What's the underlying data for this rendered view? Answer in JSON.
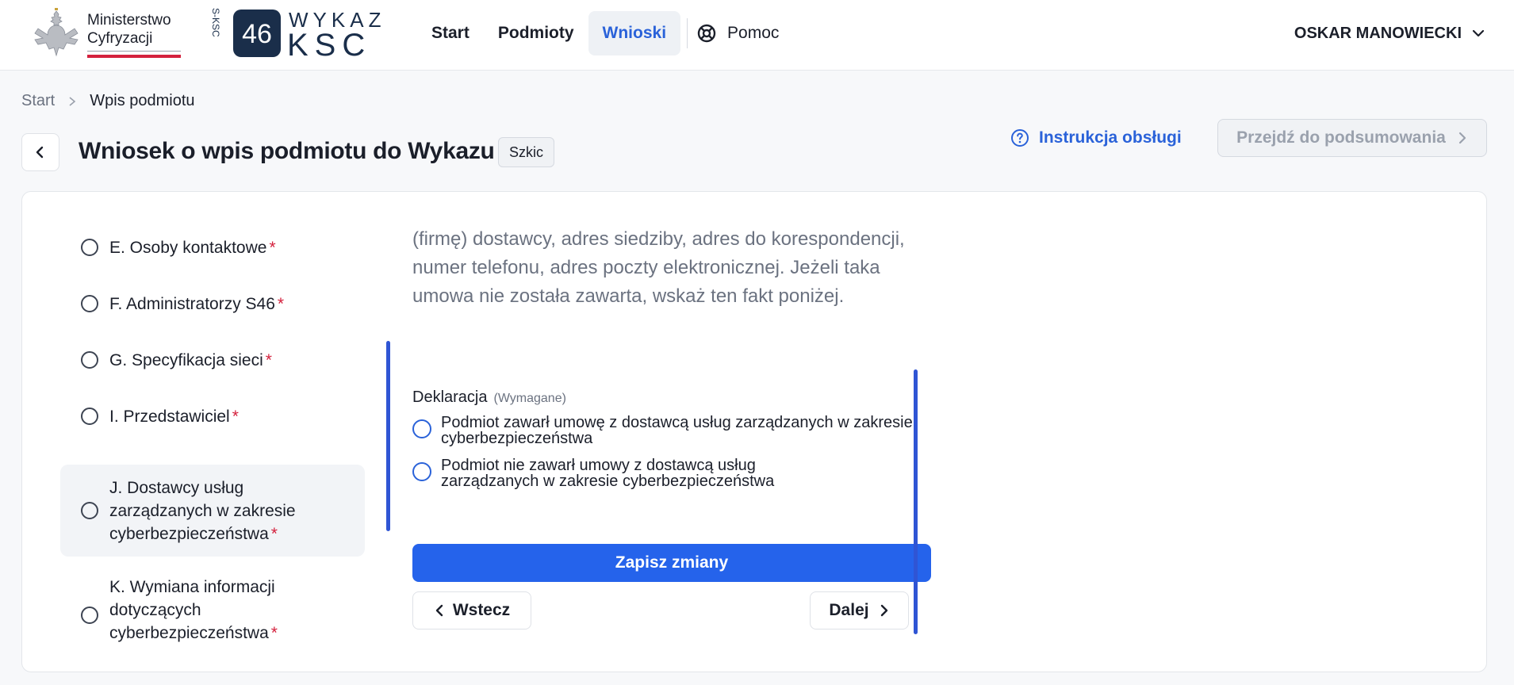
{
  "header": {
    "ministry_line1": "Ministerstwo",
    "ministry_line2": "Cyfryzacji",
    "ksc_logo_left": "S-KSC",
    "ksc_logo_number": "46",
    "ksc_logo_top": "WYKAZ",
    "ksc_logo_bottom": "KSC",
    "nav": [
      {
        "label": "Start"
      },
      {
        "label": "Podmioty"
      },
      {
        "label": "Wnioski",
        "active": true
      },
      {
        "label": "Pomoc",
        "icon": "lifebuoy-icon"
      }
    ],
    "user_name": "OSKAR MANOWIECKI"
  },
  "breadcrumb": {
    "items": [
      "Start",
      "Wpis podmiotu"
    ]
  },
  "page": {
    "title": "Wniosek o wpis podmiotu do Wykazu",
    "status": "Szkic",
    "instruction_link": "Instrukcja obsługi",
    "summary_button": "Przejdź do podsumowania"
  },
  "steps": [
    {
      "label": "E. Osoby kontaktowe",
      "required": "*"
    },
    {
      "label": "F. Administratorzy S46",
      "required": "*"
    },
    {
      "label": "G. Specyfikacja sieci",
      "required": "*"
    },
    {
      "label": "I. Przedstawiciel",
      "required": "*"
    },
    {
      "label": "J. Dostawcy usług zarządzanych w zakresie cyberbezpieczeństwa",
      "required": "*",
      "active": true
    },
    {
      "label": "K. Wymiana informacji dotyczących cyberbezpieczeństwa",
      "required": "*"
    }
  ],
  "content": {
    "description": "(firmę) dostawcy, adres siedziby, adres do korespondencji, numer telefonu, adres poczty elektronicznej. Jeżeli taka umowa nie została zawarta, wskaż ten fakt poniżej.",
    "declaration_title": "Deklaracja",
    "declaration_required": "(Wymagane)",
    "options": [
      "Podmiot zawarł umowę z dostawcą usług zarządzanych w zakresie cyberbezpieczeństwa",
      "Podmiot nie zawarł umowy z dostawcą usług zarządzanych w zakresie cyberbezpieczeństwa"
    ],
    "save_button": "Zapisz zmiany",
    "prev_button": "Wstecz",
    "next_button": "Dalej"
  },
  "colors": {
    "accent": "#2563eb",
    "nav_active": "#2a62d9",
    "required": "#d4213d",
    "scroll": "#2f55d4"
  }
}
